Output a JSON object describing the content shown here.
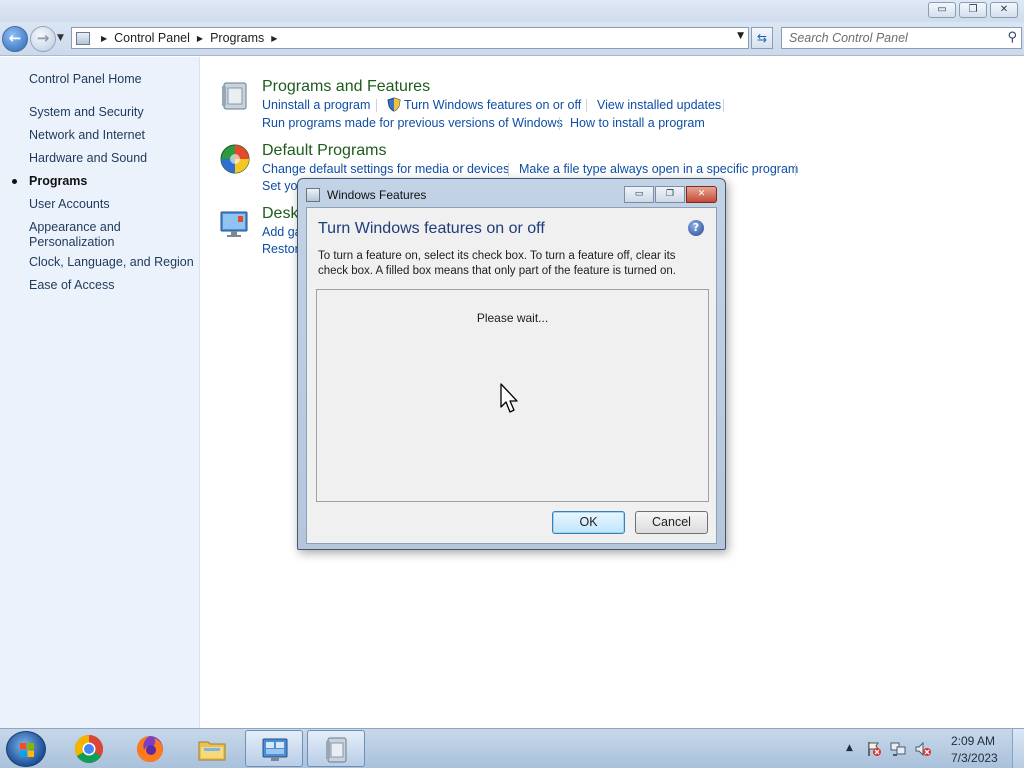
{
  "window": {
    "minimize_glyph": "▭",
    "restore_glyph": "❐",
    "close_glyph": "✕"
  },
  "navigation": {
    "back_glyph": "←",
    "forward_glyph": "→",
    "breadcrumbs": [
      "Control Panel",
      "Programs"
    ],
    "search_placeholder": "Search Control Panel"
  },
  "sidebar": {
    "items": [
      {
        "label": "Control Panel Home",
        "active": false
      },
      {
        "label": "System and Security",
        "active": false
      },
      {
        "label": "Network and Internet",
        "active": false
      },
      {
        "label": "Hardware and Sound",
        "active": false
      },
      {
        "label": "Programs",
        "active": true
      },
      {
        "label": "User Accounts",
        "active": false
      },
      {
        "label": "Appearance and Personalization",
        "active": false
      },
      {
        "label": "Clock, Language, and Region",
        "active": false
      },
      {
        "label": "Ease of Access",
        "active": false
      }
    ]
  },
  "categories": {
    "programs_features": {
      "title": "Programs and Features",
      "links": [
        "Uninstall a program",
        "Turn Windows features on or off",
        "View installed updates",
        "Run programs made for previous versions of Windows",
        "How to install a program"
      ]
    },
    "default_programs": {
      "title": "Default Programs",
      "links": [
        "Change default settings for media or devices",
        "Make a file type always open in a specific program",
        "Set you"
      ]
    },
    "desktop_gadgets": {
      "title": "Desk",
      "links": [
        "Add ga",
        "Restore"
      ]
    }
  },
  "dialog": {
    "title": "Windows Features",
    "heading": "Turn Windows features on or off",
    "description": "To turn a feature on, select its check box. To turn a feature off, clear its check box. A filled box means that only part of the feature is turned on.",
    "status": "Please wait...",
    "ok_label": "OK",
    "cancel_label": "Cancel",
    "help_glyph": "?"
  },
  "taskbar": {
    "apps": [
      "Google Chrome",
      "Firefox",
      "Windows Explorer",
      "Control Panel",
      "Windows Features"
    ],
    "time": "2:09 AM",
    "date": "7/3/2023"
  },
  "colors": {
    "link": "#0f4ea6",
    "category_title": "#1c5c1c",
    "sidebar_bg": "#ecf2fb",
    "dialog_heading": "#1f3c7a"
  }
}
